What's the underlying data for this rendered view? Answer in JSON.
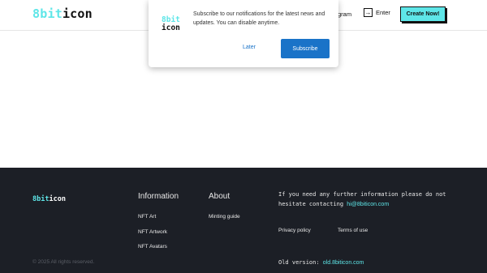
{
  "header": {
    "logo_part1": "8bit",
    "logo_part2": "icon",
    "nav_instagram": "gram",
    "enter_label": "Enter",
    "create_label": "Create Now!"
  },
  "popup": {
    "logo_part1": "8bit",
    "logo_part2": "icon",
    "message": "Subscribe to our notifications for the latest news and updates. You can disable anytime.",
    "later_label": "Later",
    "subscribe_label": "Subscribe"
  },
  "footer": {
    "logo_part1": "8bit",
    "logo_part2": "icon",
    "information": {
      "title": "Information",
      "links": [
        "NFT Art",
        "NFT Artwork",
        "NFT Avatars"
      ]
    },
    "about": {
      "title": "About",
      "links": [
        "Minting guide"
      ]
    },
    "contact_text": "If you need any further information please do not hesitate contacting",
    "contact_email": "hi@8biticon.com",
    "privacy_label": "Privacy policy",
    "terms_label": "Terms of use",
    "old_version_label": "Old version:",
    "old_version_link": "old.8biticon.com",
    "copyright": "© 2025 All rights reserved."
  },
  "colors": {
    "accent": "#5ee6e8",
    "footer_bg": "#1c1f26",
    "button_blue": "#1a73c8"
  }
}
